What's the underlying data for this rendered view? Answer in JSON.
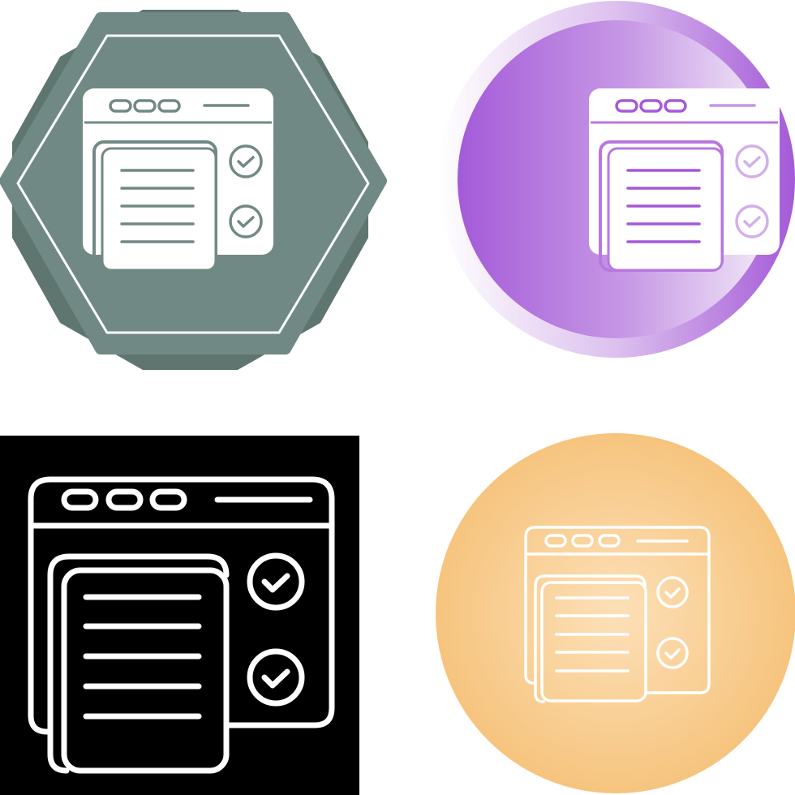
{
  "colors": {
    "badge_back": "#5f7570",
    "badge_front": "#718985",
    "purple_dark": "#a45ad8",
    "purple_light": "#e8d4f3",
    "black_bg": "#000000",
    "orange_center": "#fde0b8",
    "orange_edge": "#f6c47e",
    "white": "#ffffff"
  },
  "icons": [
    {
      "name": "checklist-window-icon",
      "style": "glyph-on-octagon-badge"
    },
    {
      "name": "checklist-window-icon",
      "style": "glyph-on-purple-circle"
    },
    {
      "name": "checklist-window-icon",
      "style": "line-on-black-square"
    },
    {
      "name": "checklist-window-icon",
      "style": "line-on-orange-circle"
    }
  ]
}
